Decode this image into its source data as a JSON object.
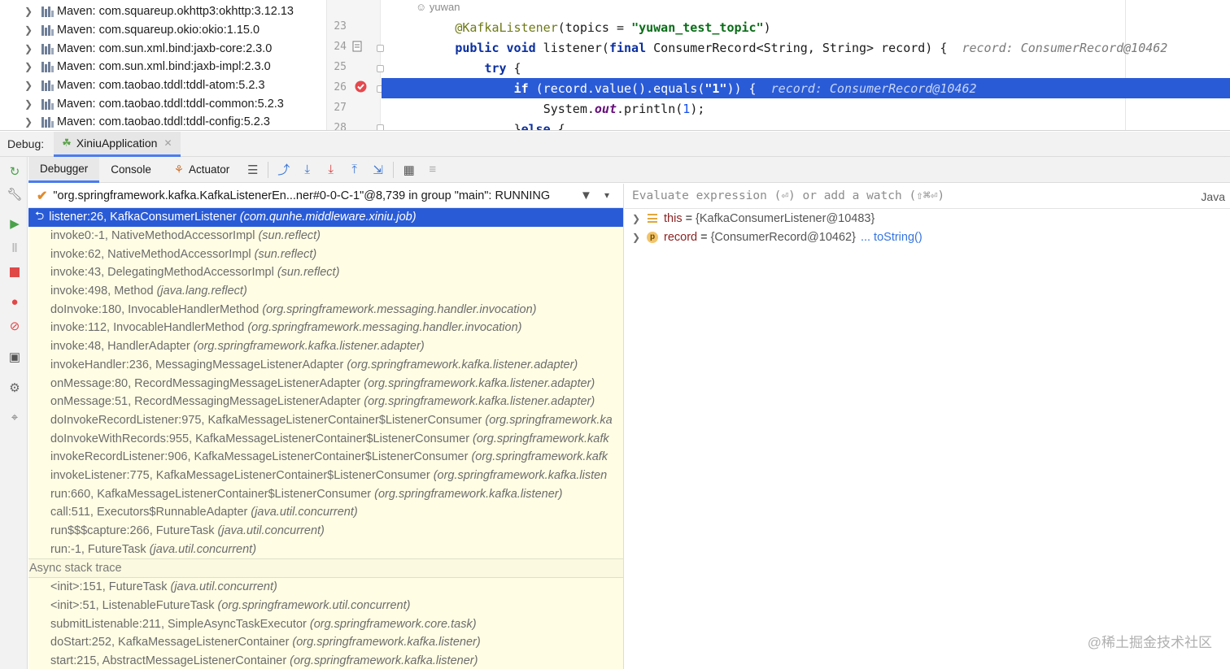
{
  "project_tree": {
    "items": [
      "Maven: com.squareup.okhttp3:okhttp:3.12.13",
      "Maven: com.squareup.okio:okio:1.15.0",
      "Maven: com.sun.xml.bind:jaxb-core:2.3.0",
      "Maven: com.sun.xml.bind:jaxb-impl:2.3.0",
      "Maven: com.taobao.tddl:tddl-atom:5.2.3",
      "Maven: com.taobao.tddl:tddl-common:5.2.3",
      "Maven: com.taobao.tddl:tddl-config:5.2.3"
    ]
  },
  "editor": {
    "author": "yuwan",
    "line_numbers": [
      "23",
      "24",
      "25",
      "26",
      "27",
      "28"
    ],
    "line23": {
      "annotation": "@KafkaListener",
      "p1": "(topics = ",
      "string": "\"yuwan_test_topic\"",
      "p2": ")"
    },
    "line24": {
      "kw1": "public",
      "kw2": "void",
      "p1": " listener(",
      "kw3": "final",
      "p2": " ConsumerRecord<String, String> record) {",
      "inlay": "record: ConsumerRecord@10462"
    },
    "line25": {
      "kw": "try",
      "p": " {"
    },
    "line26": {
      "kw": "if",
      "p1": " (record.value().equals(",
      "string": "\"1\"",
      "p2": ")) {",
      "inlay": "record: ConsumerRecord@10462"
    },
    "line27": {
      "p1": "System.",
      "static": "out",
      "p2": ".println(",
      "num": "1",
      "p3": ");"
    },
    "line28": {
      "p1": "}",
      "kw": "else",
      "p2": " {"
    }
  },
  "debug_header": {
    "label": "Debug:",
    "run_tab": "XiniuApplication"
  },
  "toolbar": {
    "tabs": [
      "Debugger",
      "Console",
      "Actuator"
    ]
  },
  "thread": {
    "text": "\"org.springframework.kafka.KafkaListenerEn...ner#0-0-C-1\"@8,739 in group \"main\": RUNNING"
  },
  "frames": [
    {
      "method": "listener:26, KafkaConsumerListener",
      "pkg": "(com.qunhe.middleware.xiniu.job)"
    },
    {
      "method": "invoke0:-1, NativeMethodAccessorImpl",
      "pkg": "(sun.reflect)"
    },
    {
      "method": "invoke:62, NativeMethodAccessorImpl",
      "pkg": "(sun.reflect)"
    },
    {
      "method": "invoke:43, DelegatingMethodAccessorImpl",
      "pkg": "(sun.reflect)"
    },
    {
      "method": "invoke:498, Method",
      "pkg": "(java.lang.reflect)"
    },
    {
      "method": "doInvoke:180, InvocableHandlerMethod",
      "pkg": "(org.springframework.messaging.handler.invocation)"
    },
    {
      "method": "invoke:112, InvocableHandlerMethod",
      "pkg": "(org.springframework.messaging.handler.invocation)"
    },
    {
      "method": "invoke:48, HandlerAdapter",
      "pkg": "(org.springframework.kafka.listener.adapter)"
    },
    {
      "method": "invokeHandler:236, MessagingMessageListenerAdapter",
      "pkg": "(org.springframework.kafka.listener.adapter)"
    },
    {
      "method": "onMessage:80, RecordMessagingMessageListenerAdapter",
      "pkg": "(org.springframework.kafka.listener.adapter)"
    },
    {
      "method": "onMessage:51, RecordMessagingMessageListenerAdapter",
      "pkg": "(org.springframework.kafka.listener.adapter)"
    },
    {
      "method": "doInvokeRecordListener:975, KafkaMessageListenerContainer$ListenerConsumer",
      "pkg": "(org.springframework.ka"
    },
    {
      "method": "doInvokeWithRecords:955, KafkaMessageListenerContainer$ListenerConsumer",
      "pkg": "(org.springframework.kafk"
    },
    {
      "method": "invokeRecordListener:906, KafkaMessageListenerContainer$ListenerConsumer",
      "pkg": "(org.springframework.kafk"
    },
    {
      "method": "invokeListener:775, KafkaMessageListenerContainer$ListenerConsumer",
      "pkg": "(org.springframework.kafka.listen"
    },
    {
      "method": "run:660, KafkaMessageListenerContainer$ListenerConsumer",
      "pkg": "(org.springframework.kafka.listener)"
    },
    {
      "method": "call:511, Executors$RunnableAdapter",
      "pkg": "(java.util.concurrent)"
    },
    {
      "method": "run$$$capture:266, FutureTask",
      "pkg": "(java.util.concurrent)"
    },
    {
      "method": "run:-1, FutureTask",
      "pkg": "(java.util.concurrent)"
    }
  ],
  "async_label": "Async stack trace",
  "async_frames": [
    {
      "method": "<init>:151, FutureTask",
      "pkg": "(java.util.concurrent)"
    },
    {
      "method": "<init>:51, ListenableFutureTask",
      "pkg": "(org.springframework.util.concurrent)"
    },
    {
      "method": "submitListenable:211, SimpleAsyncTaskExecutor",
      "pkg": "(org.springframework.core.task)"
    },
    {
      "method": "doStart:252, KafkaMessageListenerContainer",
      "pkg": "(org.springframework.kafka.listener)"
    },
    {
      "method": "start:215, AbstractMessageListenerContainer",
      "pkg": "(org.springframework.kafka.listener)"
    }
  ],
  "evaluate": {
    "placeholder": "Evaluate expression (⏎) or add a watch (⇧⌘⏎)",
    "language": "Java"
  },
  "variables": [
    {
      "name": "this",
      "value": "{KafkaConsumerListener@10483}",
      "icon": "field-lines-icon"
    },
    {
      "name": "record",
      "value": "{ConsumerRecord@10462}",
      "link": "... toString()",
      "icon": "parameter-icon",
      "icon_letter": "p"
    }
  ],
  "watermark": "@稀土掘金技术社区"
}
